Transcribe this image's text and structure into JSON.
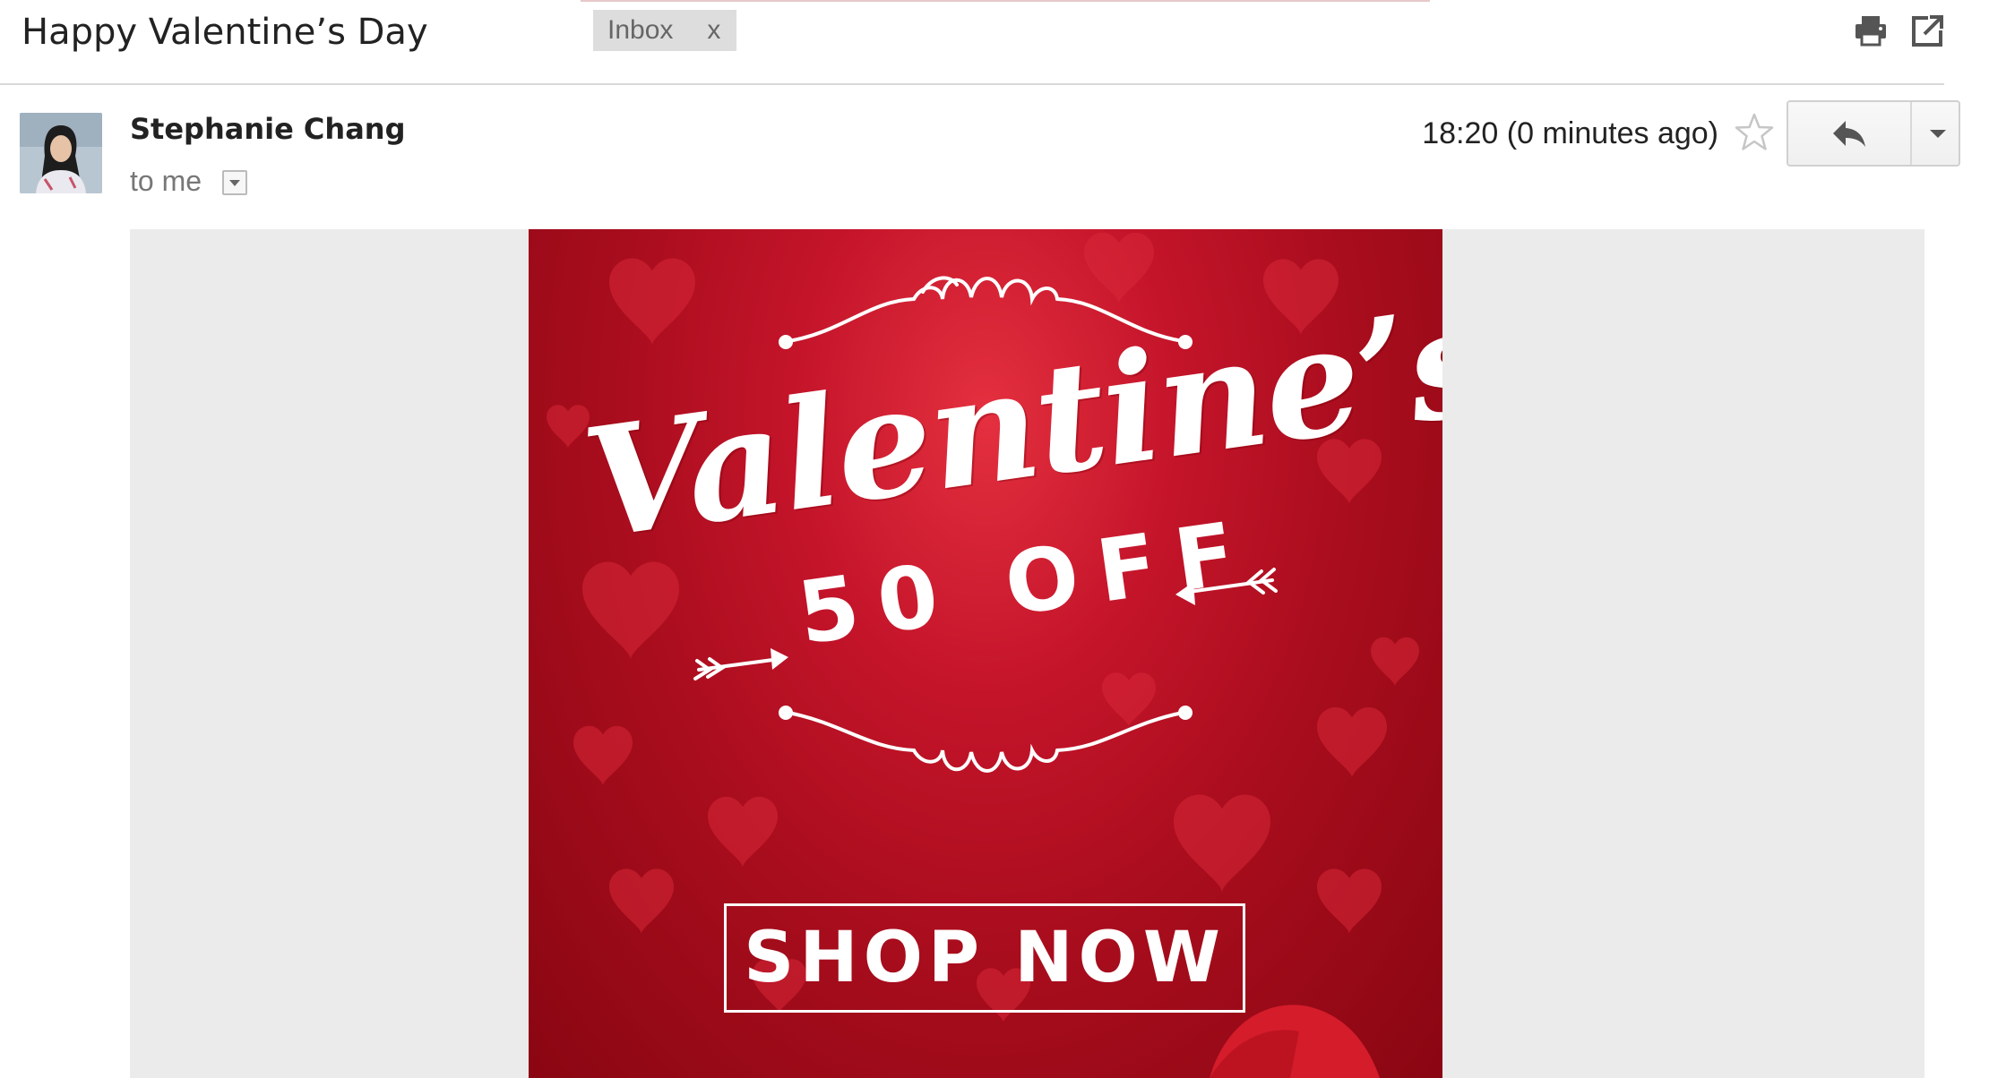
{
  "header": {
    "subject": "Happy Valentine’s Day",
    "label": "Inbox",
    "label_remove": "x",
    "print_icon": "print-icon",
    "new_window_icon": "open-in-new-window-icon"
  },
  "message": {
    "sender_name": "Stephanie Chang",
    "recipient": "to me",
    "timestamp": "18:20 (0 minutes ago)",
    "star_icon": "star-icon",
    "reply_icon": "reply-icon",
    "more_icon": "chevron-down-icon"
  },
  "banner": {
    "title": "Valentine’s",
    "offer": "50 OFF",
    "cta": "SHOP NOW",
    "colors": {
      "background": "#b3101f",
      "text": "#ffffff"
    }
  }
}
